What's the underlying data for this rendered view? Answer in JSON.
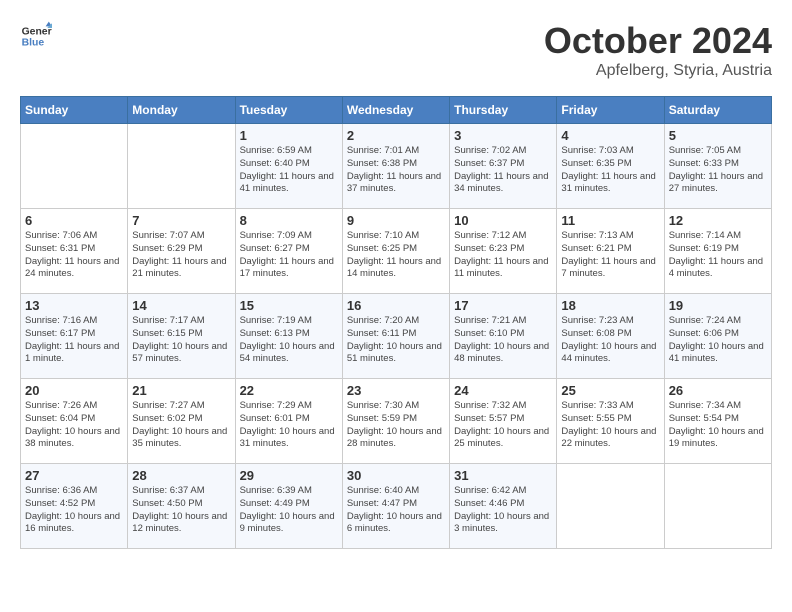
{
  "header": {
    "logo_line1": "General",
    "logo_line2": "Blue",
    "month": "October 2024",
    "location": "Apfelberg, Styria, Austria"
  },
  "days_of_week": [
    "Sunday",
    "Monday",
    "Tuesday",
    "Wednesday",
    "Thursday",
    "Friday",
    "Saturday"
  ],
  "weeks": [
    [
      {
        "day": "",
        "info": ""
      },
      {
        "day": "",
        "info": ""
      },
      {
        "day": "1",
        "info": "Sunrise: 6:59 AM\nSunset: 6:40 PM\nDaylight: 11 hours and 41 minutes."
      },
      {
        "day": "2",
        "info": "Sunrise: 7:01 AM\nSunset: 6:38 PM\nDaylight: 11 hours and 37 minutes."
      },
      {
        "day": "3",
        "info": "Sunrise: 7:02 AM\nSunset: 6:37 PM\nDaylight: 11 hours and 34 minutes."
      },
      {
        "day": "4",
        "info": "Sunrise: 7:03 AM\nSunset: 6:35 PM\nDaylight: 11 hours and 31 minutes."
      },
      {
        "day": "5",
        "info": "Sunrise: 7:05 AM\nSunset: 6:33 PM\nDaylight: 11 hours and 27 minutes."
      }
    ],
    [
      {
        "day": "6",
        "info": "Sunrise: 7:06 AM\nSunset: 6:31 PM\nDaylight: 11 hours and 24 minutes."
      },
      {
        "day": "7",
        "info": "Sunrise: 7:07 AM\nSunset: 6:29 PM\nDaylight: 11 hours and 21 minutes."
      },
      {
        "day": "8",
        "info": "Sunrise: 7:09 AM\nSunset: 6:27 PM\nDaylight: 11 hours and 17 minutes."
      },
      {
        "day": "9",
        "info": "Sunrise: 7:10 AM\nSunset: 6:25 PM\nDaylight: 11 hours and 14 minutes."
      },
      {
        "day": "10",
        "info": "Sunrise: 7:12 AM\nSunset: 6:23 PM\nDaylight: 11 hours and 11 minutes."
      },
      {
        "day": "11",
        "info": "Sunrise: 7:13 AM\nSunset: 6:21 PM\nDaylight: 11 hours and 7 minutes."
      },
      {
        "day": "12",
        "info": "Sunrise: 7:14 AM\nSunset: 6:19 PM\nDaylight: 11 hours and 4 minutes."
      }
    ],
    [
      {
        "day": "13",
        "info": "Sunrise: 7:16 AM\nSunset: 6:17 PM\nDaylight: 11 hours and 1 minute."
      },
      {
        "day": "14",
        "info": "Sunrise: 7:17 AM\nSunset: 6:15 PM\nDaylight: 10 hours and 57 minutes."
      },
      {
        "day": "15",
        "info": "Sunrise: 7:19 AM\nSunset: 6:13 PM\nDaylight: 10 hours and 54 minutes."
      },
      {
        "day": "16",
        "info": "Sunrise: 7:20 AM\nSunset: 6:11 PM\nDaylight: 10 hours and 51 minutes."
      },
      {
        "day": "17",
        "info": "Sunrise: 7:21 AM\nSunset: 6:10 PM\nDaylight: 10 hours and 48 minutes."
      },
      {
        "day": "18",
        "info": "Sunrise: 7:23 AM\nSunset: 6:08 PM\nDaylight: 10 hours and 44 minutes."
      },
      {
        "day": "19",
        "info": "Sunrise: 7:24 AM\nSunset: 6:06 PM\nDaylight: 10 hours and 41 minutes."
      }
    ],
    [
      {
        "day": "20",
        "info": "Sunrise: 7:26 AM\nSunset: 6:04 PM\nDaylight: 10 hours and 38 minutes."
      },
      {
        "day": "21",
        "info": "Sunrise: 7:27 AM\nSunset: 6:02 PM\nDaylight: 10 hours and 35 minutes."
      },
      {
        "day": "22",
        "info": "Sunrise: 7:29 AM\nSunset: 6:01 PM\nDaylight: 10 hours and 31 minutes."
      },
      {
        "day": "23",
        "info": "Sunrise: 7:30 AM\nSunset: 5:59 PM\nDaylight: 10 hours and 28 minutes."
      },
      {
        "day": "24",
        "info": "Sunrise: 7:32 AM\nSunset: 5:57 PM\nDaylight: 10 hours and 25 minutes."
      },
      {
        "day": "25",
        "info": "Sunrise: 7:33 AM\nSunset: 5:55 PM\nDaylight: 10 hours and 22 minutes."
      },
      {
        "day": "26",
        "info": "Sunrise: 7:34 AM\nSunset: 5:54 PM\nDaylight: 10 hours and 19 minutes."
      }
    ],
    [
      {
        "day": "27",
        "info": "Sunrise: 6:36 AM\nSunset: 4:52 PM\nDaylight: 10 hours and 16 minutes."
      },
      {
        "day": "28",
        "info": "Sunrise: 6:37 AM\nSunset: 4:50 PM\nDaylight: 10 hours and 12 minutes."
      },
      {
        "day": "29",
        "info": "Sunrise: 6:39 AM\nSunset: 4:49 PM\nDaylight: 10 hours and 9 minutes."
      },
      {
        "day": "30",
        "info": "Sunrise: 6:40 AM\nSunset: 4:47 PM\nDaylight: 10 hours and 6 minutes."
      },
      {
        "day": "31",
        "info": "Sunrise: 6:42 AM\nSunset: 4:46 PM\nDaylight: 10 hours and 3 minutes."
      },
      {
        "day": "",
        "info": ""
      },
      {
        "day": "",
        "info": ""
      }
    ]
  ]
}
